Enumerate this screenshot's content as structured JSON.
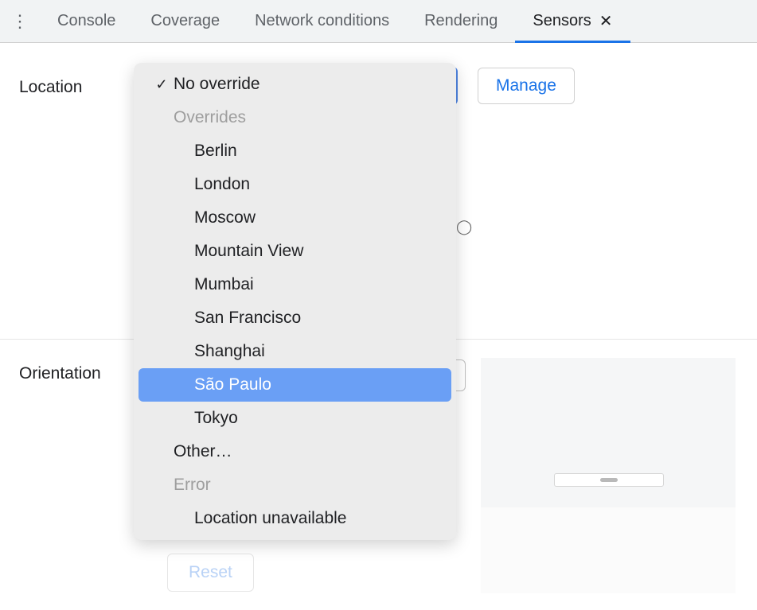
{
  "tabs": {
    "console": "Console",
    "coverage": "Coverage",
    "network_conditions": "Network conditions",
    "rendering": "Rendering",
    "sensors": "Sensors"
  },
  "location": {
    "label": "Location",
    "manage": "Manage",
    "dropdown": {
      "no_override": "No override",
      "group_overrides": "Overrides",
      "berlin": "Berlin",
      "london": "London",
      "moscow": "Moscow",
      "mountain_view": "Mountain View",
      "mumbai": "Mumbai",
      "san_francisco": "San Francisco",
      "shanghai": "Shanghai",
      "sao_paulo": "São Paulo",
      "tokyo": "Tokyo",
      "other": "Other…",
      "group_error": "Error",
      "location_unavailable": "Location unavailable"
    }
  },
  "orientation": {
    "label": "Orientation",
    "reset": "Reset"
  }
}
